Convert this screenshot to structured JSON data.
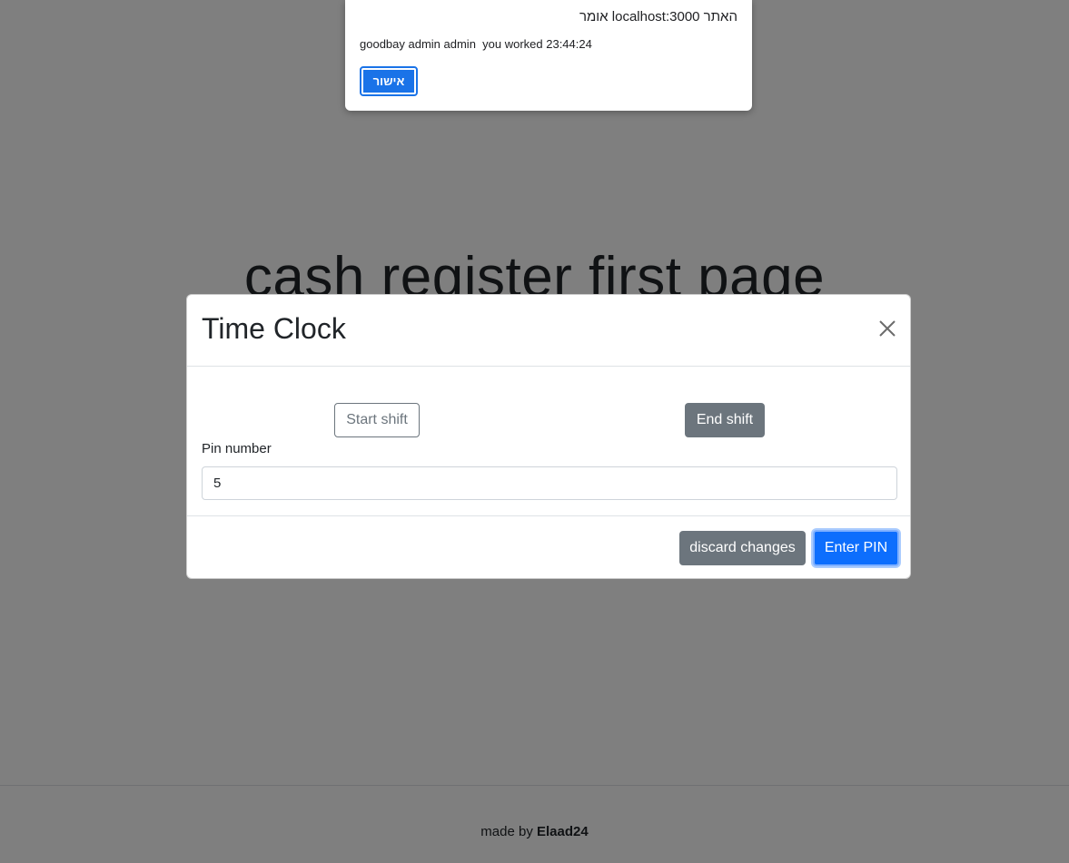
{
  "page": {
    "heading": "cash register first page",
    "footer": {
      "prefix": "made by ",
      "author": "Elaad24"
    }
  },
  "modal": {
    "title": "Time Clock",
    "close_icon": "close-icon",
    "start_shift_label": "Start shift",
    "end_shift_label": "End shift",
    "pin_label": "Pin number",
    "pin_value": "5",
    "discard_label": "discard changes",
    "enter_label": "Enter PIN"
  },
  "alert": {
    "title": "האתר localhost:3000 אומר",
    "message": "goodbay admin admin  you worked 23:44:24",
    "ok_label": "אישור"
  },
  "colors": {
    "primary": "#0d6efd",
    "secondary": "#6c757d",
    "alert_button": "#1a73e8"
  }
}
